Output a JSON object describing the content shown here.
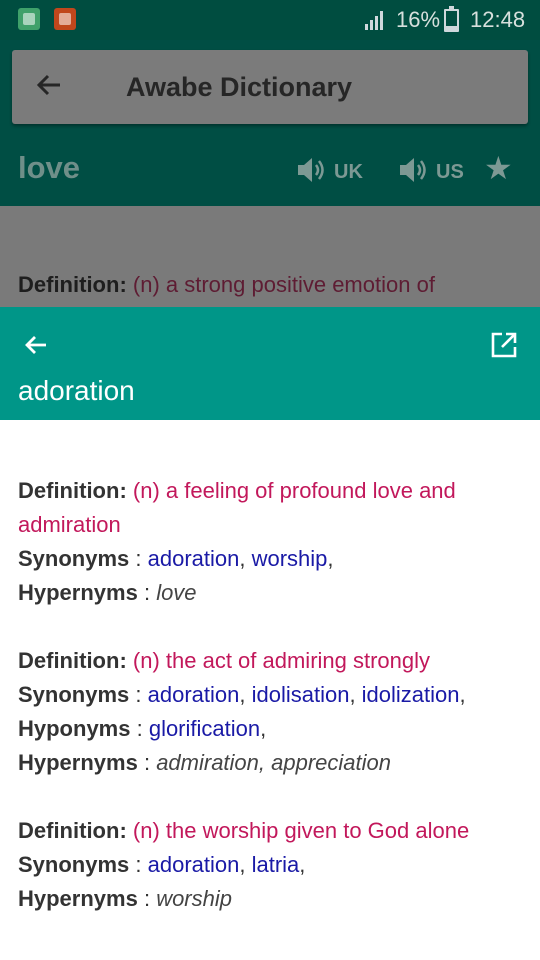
{
  "status_bar": {
    "battery_pct": "16%",
    "time": "12:48",
    "icons": [
      "notification-app-icon",
      "notification-app-icon",
      "signal-icon",
      "battery-icon"
    ]
  },
  "background_app": {
    "title": "Awabe Dictionary",
    "word": "love",
    "pron_uk": "UK",
    "pron_us": "US",
    "def_label": "Definition",
    "def_colon": ":",
    "def_text": "(n) a strong positive emotion of",
    "icons": [
      "back-arrow-icon",
      "speaker-icon",
      "speaker-icon",
      "star-icon"
    ]
  },
  "sheet": {
    "word": "adoration",
    "icons": [
      "back-arrow-icon",
      "open-external-icon"
    ],
    "entries": [
      {
        "def_label": "Definition",
        "def_colon": ":",
        "def_text": "(n) a feeling of profound love and admiration",
        "syn_label": "Synonyms",
        "syn_colon": " : ",
        "synonyms": [
          "adoration",
          "worship"
        ],
        "hyper_label": "Hypernyms",
        "hyper_colon": " :  ",
        "hypernyms": "love"
      },
      {
        "def_label": "Definition",
        "def_colon": ":",
        "def_text": "(n) the act of admiring strongly",
        "syn_label": "Synonyms",
        "syn_colon": " : ",
        "synonyms": [
          "adoration",
          "idolisation",
          "idolization"
        ],
        "hypo_label": "Hyponyms",
        "hypo_colon": " : ",
        "hyponyms": [
          "glorification"
        ],
        "hyper_label": "Hypernyms",
        "hyper_colon": " :  ",
        "hypernyms": "admiration, appreciation"
      },
      {
        "def_label": "Definition",
        "def_colon": ":",
        "def_text": "(n) the worship given to God alone",
        "syn_label": "Synonyms",
        "syn_colon": " : ",
        "synonyms": [
          "adoration",
          "latria"
        ],
        "hyper_label": "Hypernyms",
        "hyper_colon": " :  ",
        "hypernyms": "worship"
      }
    ]
  },
  "colors": {
    "status_bar": "#004d40",
    "sheet_header": "#009688",
    "definition": "#c2185b",
    "link": "#1a1aa6",
    "label": "#333333"
  }
}
